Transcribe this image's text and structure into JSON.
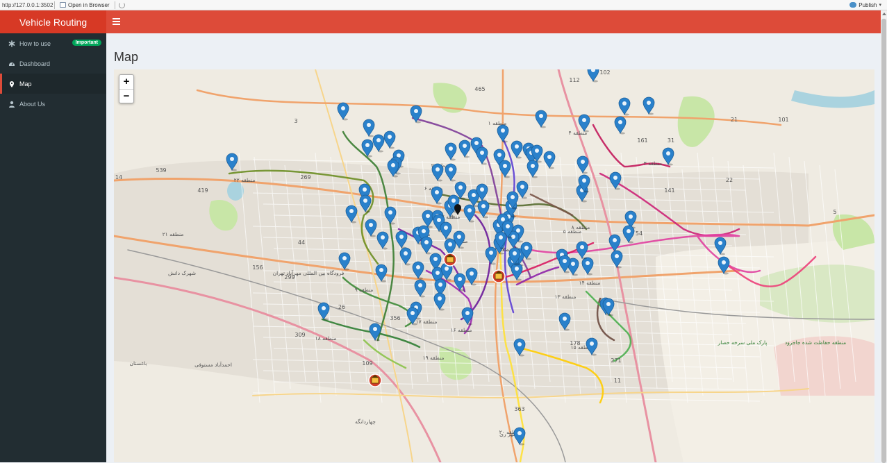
{
  "viewer": {
    "url": "http://127.0.0.1:3502",
    "open_label": "Open in Browser",
    "publish_label": "Publish"
  },
  "app": {
    "title": "Vehicle Routing"
  },
  "sidebar": {
    "items": [
      {
        "label": "How to use",
        "icon": "asterisk-icon",
        "badge": "Important"
      },
      {
        "label": "Dashboard",
        "icon": "dashboard-icon"
      },
      {
        "label": "Map",
        "icon": "map-marker-icon",
        "active": true
      },
      {
        "label": "About Us",
        "icon": "user-icon"
      }
    ]
  },
  "page": {
    "title": "Map"
  },
  "map": {
    "zoom_in": "+",
    "zoom_out": "−",
    "colors": {
      "marker": "#2a81cb",
      "depot": "#d33d2a",
      "background": "#efebe2",
      "park": "#c8e6a7"
    },
    "labels": [
      "منطقه ۱",
      "منطقه ۲",
      "منطقه ۳",
      "منطقه ۴",
      "منطقه ۵",
      "منطقه ۶",
      "منطقه ۷",
      "منطقه ۸",
      "منطقه ۹",
      "منطقه ۱۰",
      "منطقه ۱۱",
      "منطقه ۱۲",
      "منطقه ۱۳",
      "منطقه ۱۴",
      "منطقه ۱۵",
      "منطقه ۱۶",
      "منطقه ۱۷",
      "منطقه ۱۸",
      "منطقه ۱۹",
      "منطقه ۲۰",
      "منطقه ۲۱",
      "منطقه ۲۲",
      "پارک ملی سرخه حصار",
      "منطقه حفاظت شده جاجرود",
      "فرودگاه بین المللی مهرآباد تهران",
      "چهاردانگه",
      "شهر ری",
      "شهرک دانش",
      "احمدآباد مستوفی",
      "باغستان",
      "465",
      "102",
      "112",
      "161",
      "31",
      "101",
      "539",
      "419",
      "269",
      "299",
      "156",
      "26",
      "44",
      "356",
      "309",
      "109",
      "141",
      "22",
      "54",
      "5",
      "178",
      "271",
      "363",
      "21",
      "11",
      "14",
      "3"
    ]
  }
}
